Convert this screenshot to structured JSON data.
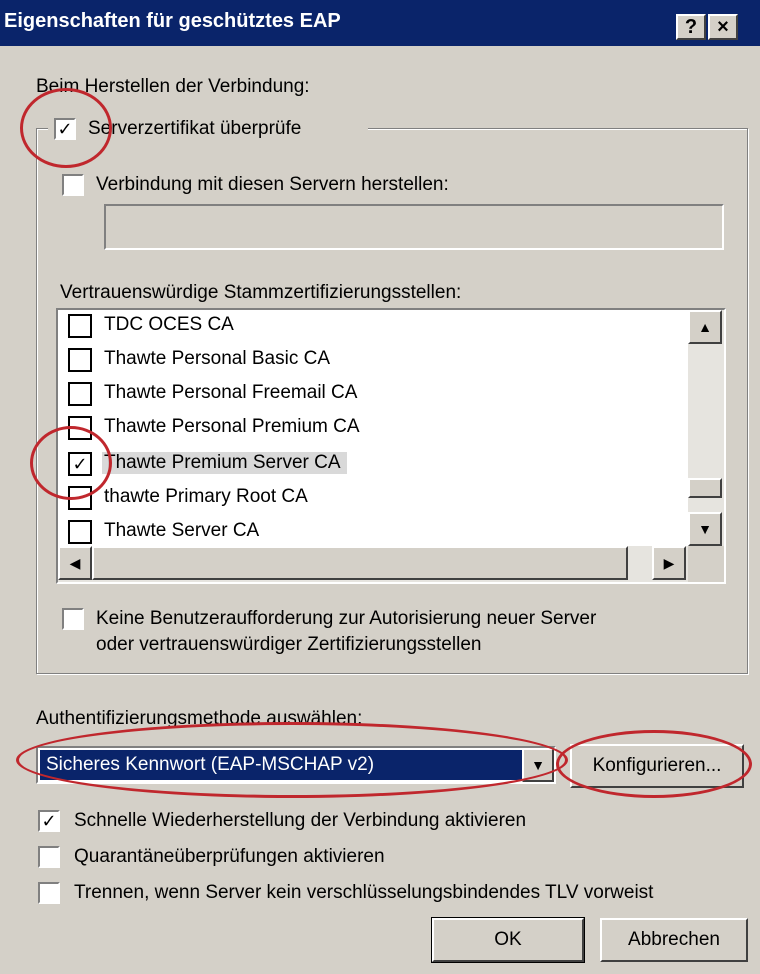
{
  "window": {
    "title": "Eigenschaften für geschütztes EAP",
    "help_button": "?",
    "close_button": "×"
  },
  "connection": {
    "label": "Beim Herstellen der Verbindung:",
    "verify_cert_label": "Serverzertifikat überprüfe",
    "verify_cert_checked": true,
    "connect_servers_label": "Verbindung mit diesen Servern herstellen:",
    "connect_servers_checked": false,
    "servers_value": "",
    "trusted_ca_label": "Vertrauenswürdige Stammzertifizierungsstellen:",
    "ca_list": [
      {
        "label": "TDC OCES CA",
        "checked": false
      },
      {
        "label": "Thawte Personal Basic CA",
        "checked": false
      },
      {
        "label": "Thawte Personal Freemail CA",
        "checked": false
      },
      {
        "label": "Thawte Personal Premium CA",
        "checked": false
      },
      {
        "label": "Thawte Premium Server CA",
        "checked": true
      },
      {
        "label": "thawte Primary Root CA",
        "checked": false
      },
      {
        "label": "Thawte Server CA",
        "checked": false
      }
    ],
    "no_prompt_label_line1": "Keine Benutzeraufforderung zur Autorisierung neuer Server",
    "no_prompt_label_line2": "oder vertrauenswürdiger Zertifizierungsstellen",
    "no_prompt_checked": false
  },
  "auth": {
    "label": "Authentifizierungsmethode auswählen:",
    "method": "Sicheres Kennwort (EAP-MSCHAP v2)",
    "configure_label": "Konfigurieren..."
  },
  "options": [
    {
      "label": "Schnelle Wiederherstellung der Verbindung aktivieren",
      "checked": true
    },
    {
      "label": "Quarantäneüberprüfungen aktivieren",
      "checked": false
    },
    {
      "label": "Trennen, wenn Server kein verschlüsselungsbindendes TLV vorweist",
      "checked": false
    }
  ],
  "buttons": {
    "ok": "OK",
    "cancel": "Abbrechen"
  },
  "colors": {
    "highlight": "#0a246a",
    "annotation": "#c0272d"
  }
}
